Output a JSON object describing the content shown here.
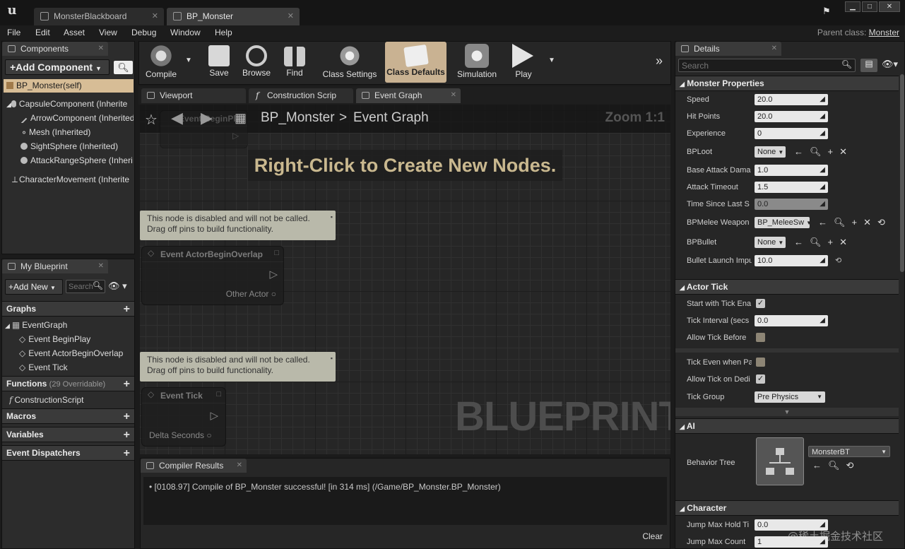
{
  "window": {
    "tabs": [
      "MonsterBlackboard",
      "BP_Monster"
    ],
    "parent_class_label": "Parent class:",
    "parent_class_value": "Monster"
  },
  "menu": [
    "File",
    "Edit",
    "Asset",
    "View",
    "Debug",
    "Window",
    "Help"
  ],
  "components": {
    "tab": "Components",
    "add_label": "+Add Component",
    "self_item": "BP_Monster(self)",
    "items": [
      "CapsuleComponent (Inherite",
      "ArrowComponent (Inherited",
      "Mesh (Inherited)",
      "SightSphere (Inherited)",
      "AttackRangeSphere (Inheri",
      "CharacterMovement (Inherite"
    ]
  },
  "my_blueprint": {
    "tab": "My Blueprint",
    "add_label": "+Add New",
    "search_placeholder": "Search",
    "graphs_label": "Graphs",
    "graph_items": [
      "EventGraph",
      "Event BeginPlay",
      "Event ActorBeginOverlap",
      "Event Tick"
    ],
    "functions_label": "Functions",
    "functions_count": "(29 Overridable)",
    "function_items": [
      "ConstructionScript"
    ],
    "macros_label": "Macros",
    "variables_label": "Variables",
    "dispatchers_label": "Event Dispatchers"
  },
  "toolbar": {
    "buttons": [
      "Compile",
      "Save",
      "Browse",
      "Find",
      "Class Settings",
      "Class Defaults",
      "Simulation",
      "Play"
    ]
  },
  "editor_tabs": [
    "Viewport",
    "Construction Scrip",
    "Event Graph"
  ],
  "graph": {
    "breadcrumb_root": "BP_Monster",
    "breadcrumb_sep": ">",
    "breadcrumb_leaf": "Event Graph",
    "zoom": "Zoom 1:1",
    "hint": "Right-Click to Create New Nodes.",
    "watermark": "BLUEPRINT",
    "note1": "This node is disabled and will not be called.",
    "note2": "Drag off pins to build functionality.",
    "node1_title": "Event ActorBeginOverlap",
    "node1_pin": "Other Actor",
    "node2_title": "Event Tick",
    "node2_pin": "Delta Seconds",
    "ghost_title": "Event BeginPlay"
  },
  "compiler": {
    "tab": "Compiler Results",
    "message": "[0108.97] Compile of BP_Monster successful! [in 314 ms] (/Game/BP_Monster.BP_Monster)",
    "clear": "Clear"
  },
  "details": {
    "tab": "Details",
    "search_placeholder": "Search",
    "monster_section": "Monster Properties",
    "monster_rows": [
      {
        "label": "Speed",
        "value": "20.0"
      },
      {
        "label": "Hit Points",
        "value": "20.0"
      },
      {
        "label": "Experience",
        "value": "0"
      }
    ],
    "bploot_label": "BPLoot",
    "bploot_value": "None",
    "monster_rows2": [
      {
        "label": "Base Attack Dama",
        "value": "1.0"
      },
      {
        "label": "Attack Timeout",
        "value": "1.5"
      },
      {
        "label": "Time Since Last S",
        "value": "0.0"
      }
    ],
    "melee_label": "BPMelee Weapon",
    "melee_value": "BP_MeleeSw",
    "bullet_label": "BPBullet",
    "bullet_value": "None",
    "launch_label": "Bullet Launch Impu",
    "launch_value": "10.0",
    "tick_section": "Actor Tick",
    "tick_rows": [
      {
        "label": "Start with Tick Ena",
        "type": "check",
        "checked": true
      },
      {
        "label": "Tick Interval (secs",
        "type": "value",
        "value": "0.0"
      },
      {
        "label": "Allow Tick Before",
        "type": "check",
        "checked": false
      },
      {
        "label": "Tick Even when Pa",
        "type": "check",
        "checked": false
      },
      {
        "label": "Allow Tick on Dedi",
        "type": "check",
        "checked": true
      }
    ],
    "tick_group_label": "Tick Group",
    "tick_group_value": "Pre Physics",
    "ai_section": "AI",
    "bt_label": "Behavior Tree",
    "bt_value": "MonsterBT",
    "char_section": "Character",
    "char_rows": [
      {
        "label": "Jump Max Hold Ti",
        "value": "0.0"
      },
      {
        "label": "Jump Max Count",
        "value": "1"
      }
    ]
  },
  "watermark_text": "@稀土掘金技术社区"
}
